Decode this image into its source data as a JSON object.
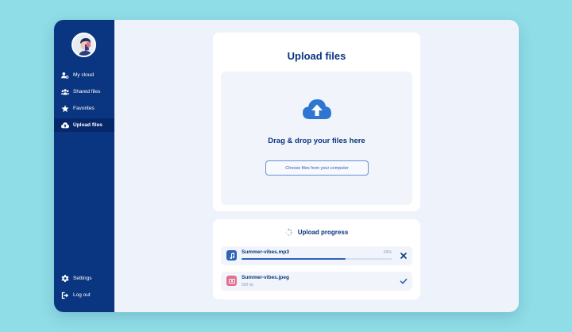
{
  "sidebar": {
    "items": [
      {
        "label": "My cloud",
        "icon": "users-icon"
      },
      {
        "label": "Shared files",
        "icon": "group-icon"
      },
      {
        "label": "Favorites",
        "icon": "star-icon"
      },
      {
        "label": "Upload files",
        "icon": "cloud-upload-icon",
        "active": true
      }
    ],
    "bottom_items": [
      {
        "label": "Settings",
        "icon": "gear-icon"
      },
      {
        "label": "Log out",
        "icon": "logout-icon"
      }
    ]
  },
  "upload": {
    "title": "Upload files",
    "drop_text": "Drag & drop your files here",
    "choose_button": "Choose files from your computer"
  },
  "progress": {
    "title": "Upload progress",
    "files": [
      {
        "name": "Summer-vibes.mp3",
        "percent_label": "69%",
        "progress": 0.69,
        "status": "uploading",
        "icon": "music-note-icon",
        "icon_color": "#2f63b8"
      },
      {
        "name": "Summer-vibes.jpeg",
        "size": "500 kb",
        "status": "done",
        "icon": "image-icon",
        "icon_color": "#e0708f"
      }
    ]
  },
  "colors": {
    "sidebar": "#0a3580",
    "accent": "#2f63b8",
    "background": "#8fdde6"
  }
}
